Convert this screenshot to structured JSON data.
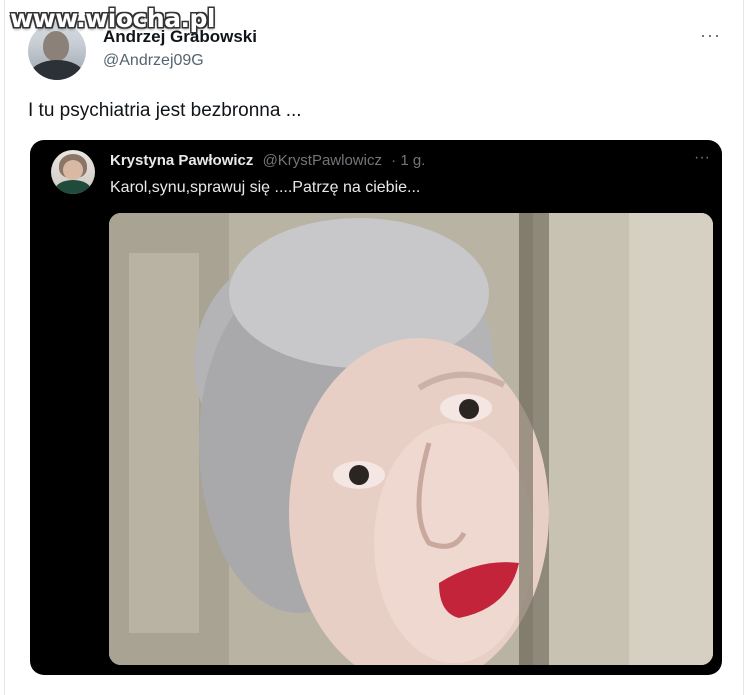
{
  "watermark": "www.wiocha.pl",
  "tweet": {
    "author_name": "Andrzej Grabowski",
    "author_handle": "@Andrzej09G",
    "more_label": "···",
    "text": "I tu psychiatria jest bezbronna ..."
  },
  "quoted": {
    "author_name": "Krystyna Pawłowicz",
    "author_handle": "@KrystPawlowicz",
    "time": "· 1 g.",
    "more_label": "···",
    "text": "Karol,synu,sprawuj się ....Patrzę na ciebie..."
  },
  "colors": {
    "text_primary": "#0f1419",
    "text_secondary": "#536471",
    "quote_bg": "#000000",
    "quote_text": "#e7e9ea",
    "quote_meta": "#71767b"
  }
}
